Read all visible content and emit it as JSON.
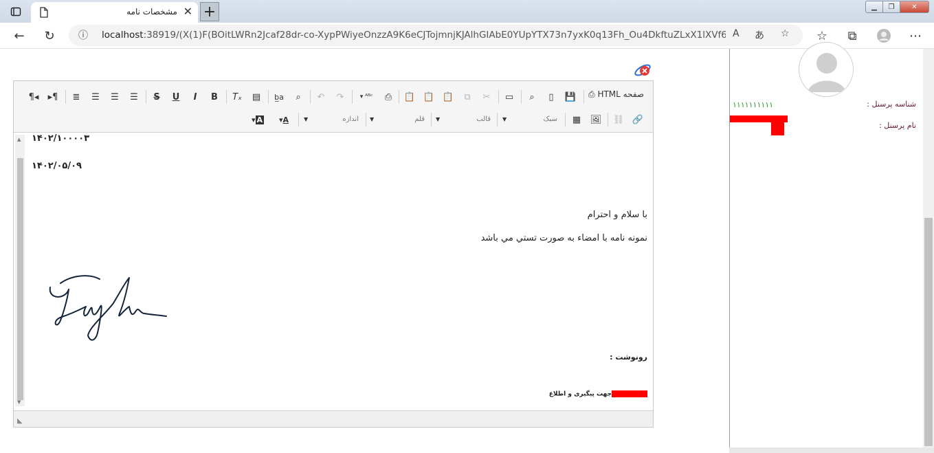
{
  "browser": {
    "tab_title": "مشخصات نامه",
    "tab_close": "✕",
    "new_tab": "+",
    "url_host": "localhost",
    "url_rest": ":38919/(X(1)F(BOitLWRn2Jcaf28dr-co-XypPWiyeOnzzA9K6eCJTojmnjKJAlhGIAbE0YUpYTX73n7yxK0q13Fh_Ou4DkftuZLxX1lXVf6_Dc4xRfX..."
  },
  "editor": {
    "source_button": "صفحه HTML",
    "combos": {
      "style": "سبک",
      "format": "قالب",
      "font": "قلم",
      "size": "اندازه"
    }
  },
  "document": {
    "letter_number": "۱۴۰۲/۱۰۰۰۰۳",
    "letter_date": "۱۴۰۲/۰۵/۰۹",
    "greeting": "با سلام و احترام",
    "body": "نمونه نامه با امضاء به صورت تستي مي باشد",
    "cc_label": "رونوشت :",
    "cc_line": "جهت پیگیری و اطلاع"
  },
  "panel": {
    "personnel_id_label": "شناسه پرسنل :",
    "personnel_id_value": "۱۱۱۱۱۱۱۱۱۱",
    "personnel_name_label": "نام پرسنل :"
  },
  "colors": {
    "accent_label": "#6b1a2e",
    "id_value": "#2a9a2a",
    "redaction": "#ff0000"
  }
}
